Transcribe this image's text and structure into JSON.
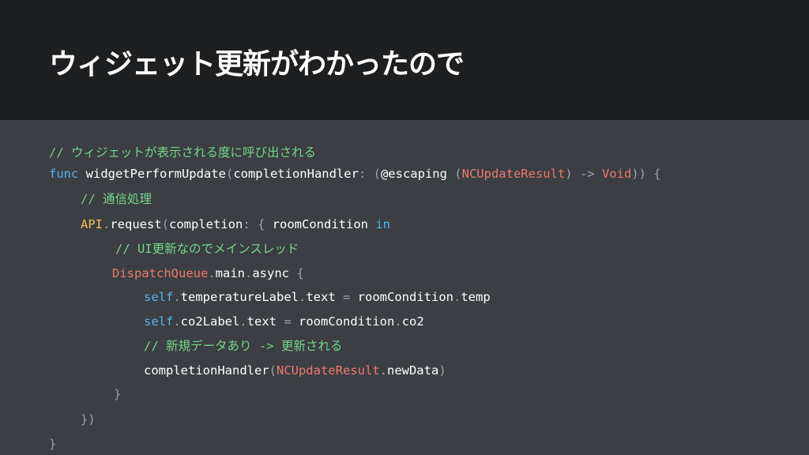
{
  "title": "ウィジェット更新がわかったので",
  "code": {
    "comment_widget": "// ウィジェットが表示される度に呼び出される",
    "kw_func": "func",
    "fn_name": " widgetPerformUpdate",
    "paren_open": "(",
    "param_label": "completionHandler",
    "colon_space": ": (",
    "escaping": "@escaping ",
    "paren2": "(",
    "type_result": "NCUpdateResult",
    "arrow": ") -> ",
    "type_void": "Void",
    "close_brace": ")) {",
    "comment_network": "// 通信処理",
    "api": "API",
    "dot_request": ".",
    "request": "request",
    "paren_completion": "(",
    "completion": "completion",
    "colon_brace": ": { ",
    "room_condition": "roomCondition ",
    "kw_in": "in",
    "comment_ui": "// UI更新なのでメインスレッド",
    "dispatch_queue": "DispatchQueue",
    "dot1": ".",
    "main": "main",
    "dot2": ".",
    "async": "async ",
    "brace_open": "{",
    "kw_self1": "self",
    "dot3": ".",
    "temp_label": "temperatureLabel",
    "dot4": ".",
    "text1": "text ",
    "eq1": "= ",
    "room1": "roomCondition",
    "dot5": ".",
    "temp": "temp",
    "kw_self2": "self",
    "dot6": ".",
    "co2_label": "co2Label",
    "dot7": ".",
    "text2": "text ",
    "eq2": "= ",
    "room2": "roomCondition",
    "dot8": ".",
    "co2": "co2",
    "comment_newdata": "// 新規データあり -> 更新される",
    "completion_handler": "completionHandler",
    "paren_open2": "(",
    "type_result2": "NCUpdateResult",
    "dot9": ".",
    "new_data": "newData",
    "paren_close2": ")",
    "close_inner": "}",
    "close_request": "})",
    "close_func": "}"
  },
  "colors": {
    "header_bg": "#1e1f21",
    "body_bg": "#3b3e43",
    "comment": "#74d68c",
    "keyword": "#5ab4e8",
    "type": "#f07a6f",
    "object": "#f2c14e"
  }
}
